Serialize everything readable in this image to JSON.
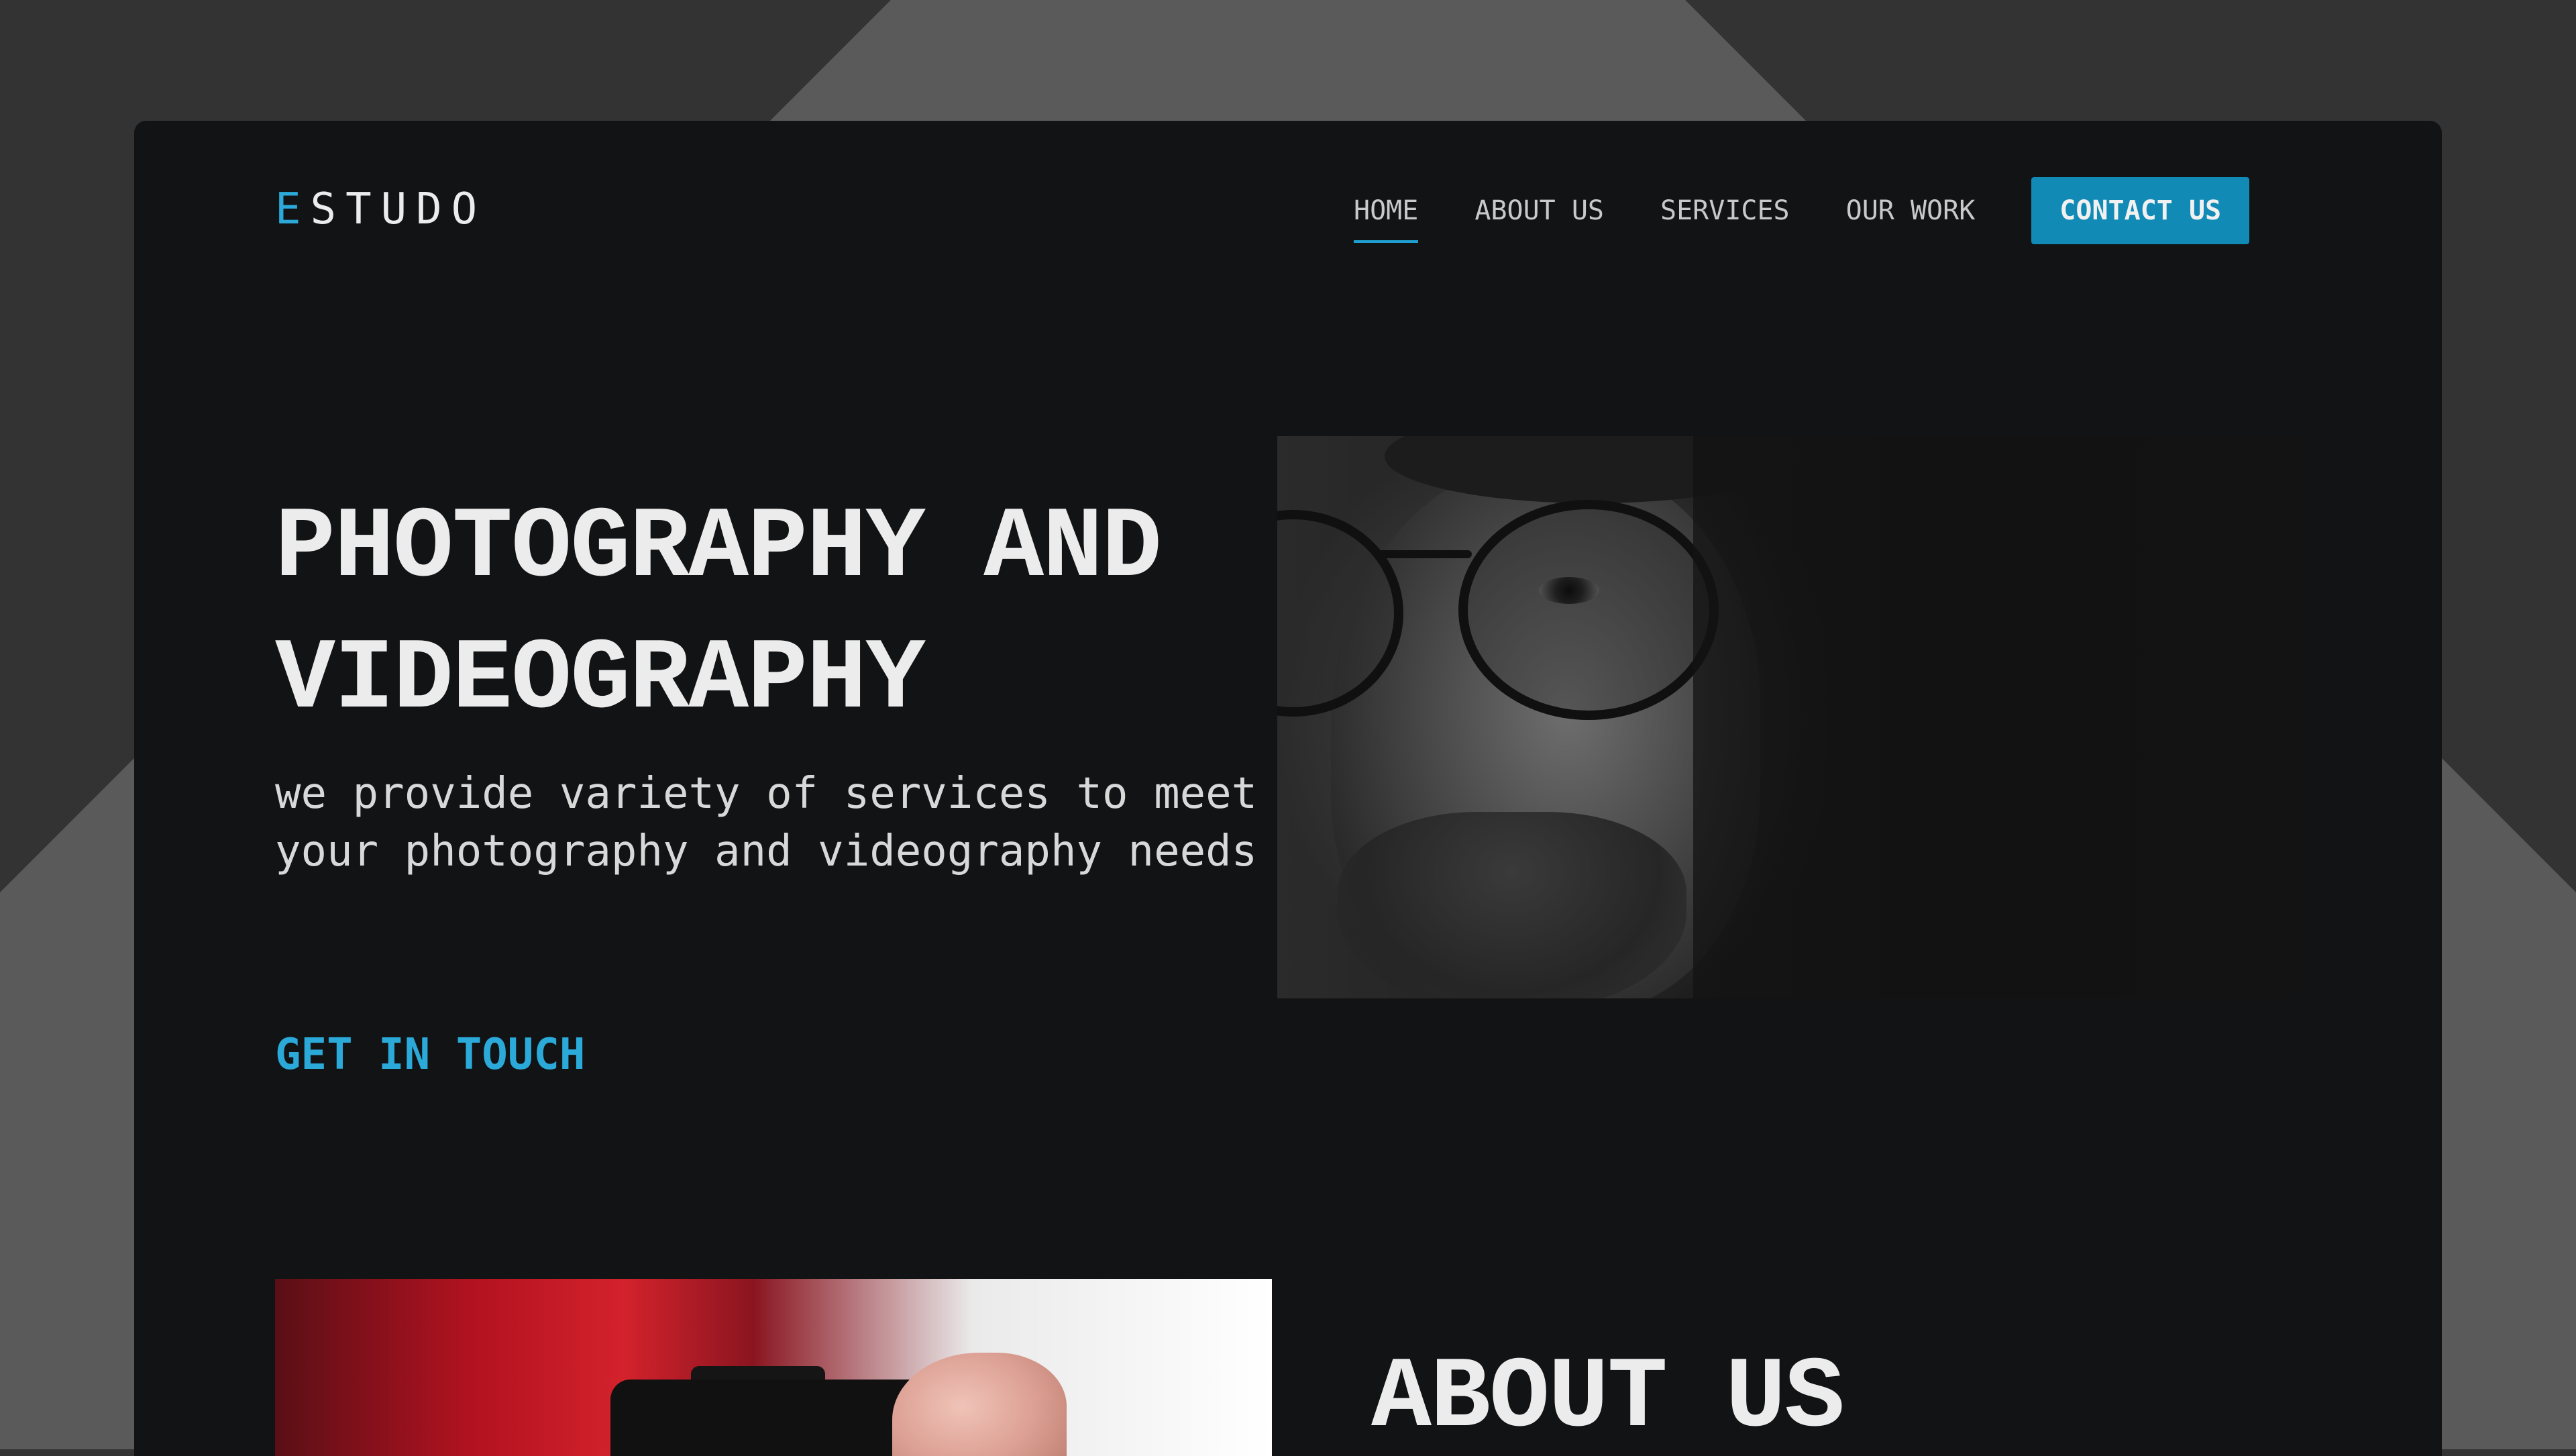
{
  "brand": {
    "logo_accent": "E",
    "logo_rest": "STUDO",
    "accent_color": "#2ba9d8"
  },
  "nav": {
    "items": [
      {
        "label": "HOME",
        "active": true
      },
      {
        "label": "ABOUT US",
        "active": false
      },
      {
        "label": "SERVICES",
        "active": false
      },
      {
        "label": "OUR WORK",
        "active": false
      }
    ],
    "contact_label": "CONTACT US"
  },
  "hero": {
    "title_line1": "PHOTOGRAPHY AND",
    "title_line2": "VIDEOGRAPHY",
    "subtitle_line1": "we provide variety of services to meet",
    "subtitle_line2": "your photography and videography needs",
    "cta_label": "GET IN TOUCH"
  },
  "about": {
    "title": "ABOUT US"
  },
  "colors": {
    "page_background": "#111315",
    "outer_background": "#333333",
    "button_background": "#118ab5"
  }
}
